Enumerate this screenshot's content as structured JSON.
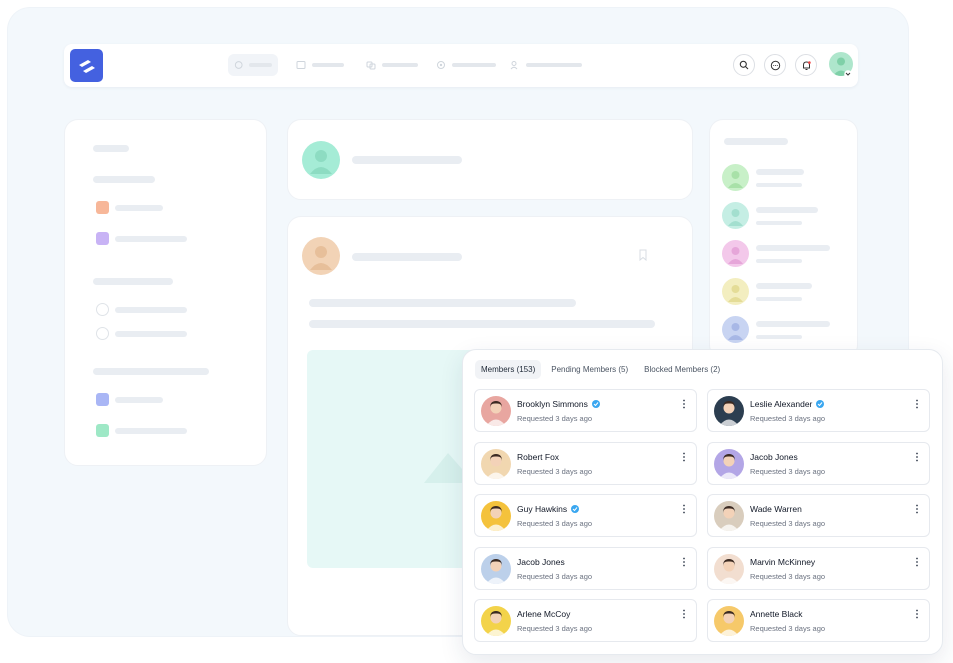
{
  "tabs": [
    {
      "label": "Members (153)",
      "active": true
    },
    {
      "label": "Pending Members (5)",
      "active": false
    },
    {
      "label": "Blocked Members (2)",
      "active": false
    }
  ],
  "members": [
    {
      "name": "Brooklyn Simmons",
      "status": "Requested 3 days ago",
      "verified": true,
      "avatar_color": "#e8a6a0"
    },
    {
      "name": "Leslie Alexander",
      "status": "Requested 3 days ago",
      "verified": true,
      "avatar_color": "#2c3e50"
    },
    {
      "name": "Robert Fox",
      "status": "Requested 3 days ago",
      "verified": false,
      "avatar_color": "#f1d7b0"
    },
    {
      "name": "Jacob Jones",
      "status": "Requested 3 days ago",
      "verified": false,
      "avatar_color": "#b3a6e6"
    },
    {
      "name": "Guy Hawkins",
      "status": "Requested 3 days ago",
      "verified": true,
      "avatar_color": "#f4c23c"
    },
    {
      "name": "Wade Warren",
      "status": "Requested 3 days ago",
      "verified": false,
      "avatar_color": "#d9cdbd"
    },
    {
      "name": "Jacob Jones",
      "status": "Requested 3 days ago",
      "verified": false,
      "avatar_color": "#bcd0ea"
    },
    {
      "name": "Marvin McKinney",
      "status": "Requested 3 days ago",
      "verified": false,
      "avatar_color": "#f2ded0"
    },
    {
      "name": "Arlene McCoy",
      "status": "Requested 3 days ago",
      "verified": false,
      "avatar_color": "#f3d34a"
    },
    {
      "name": "Annette Black",
      "status": "Requested 3 days ago",
      "verified": false,
      "avatar_color": "#f6c96a"
    }
  ],
  "colors": {
    "brand": "#4461e0",
    "verified": "#3aa7f0",
    "background": "#f3f8fc"
  }
}
